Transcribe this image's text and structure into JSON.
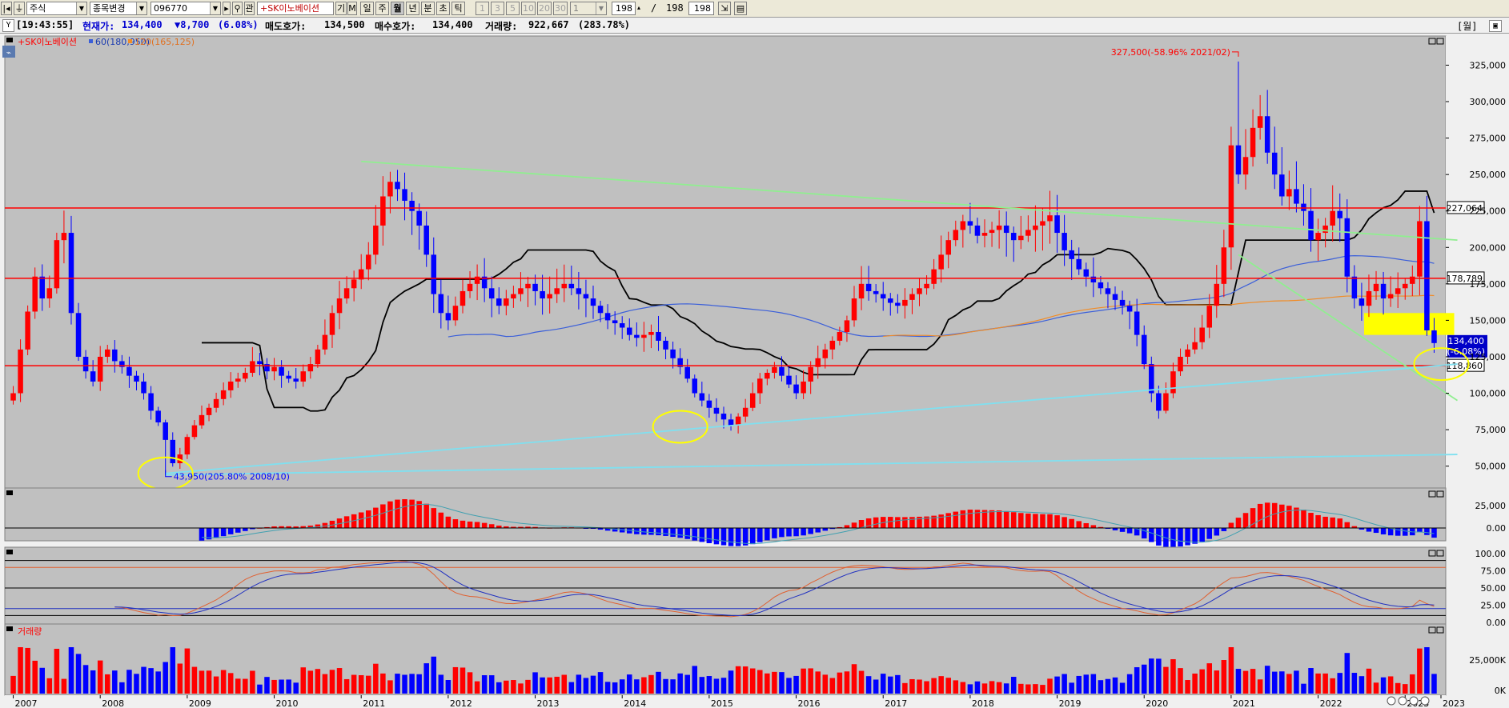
{
  "toolbar": {
    "market_type": "주식",
    "change_item": "종목변경",
    "code": "096770",
    "search_label": "관",
    "stock_name": "+SK이노베이션",
    "btn_gi": "기",
    "btn_m": "M",
    "periods": [
      "일",
      "주",
      "월",
      "년",
      "분",
      "초",
      "틱"
    ],
    "selected_period": "월",
    "intervals": [
      "1",
      "3",
      "5",
      "10",
      "20",
      "30"
    ],
    "interval_value": "1",
    "count_value": "198",
    "count_separator": "/",
    "count_total": "198",
    "count_input2": "198",
    "top_right_label": "[월]"
  },
  "infobar": {
    "time": "[19:43:55]",
    "current_price_label": "현재가:",
    "current_price": "134,400",
    "change": "▼8,700",
    "change_pct": "(6.08%)",
    "ask_label": "매도호가:",
    "ask": "134,500",
    "bid_label": "매수호가:",
    "bid": "134,400",
    "volume_label": "거래량:",
    "volume": "922,667",
    "volume_pct": "(283.78%)"
  },
  "legend": {
    "name": "+SK이노베이션",
    "ma60": "60(180,950)",
    "ma120": "120(165,125)",
    "volume_panel_title": "거래량"
  },
  "colors": {
    "up": "#ff0000",
    "down": "#0000ff",
    "background": "#c0c0c0",
    "ma60": "#3b5fd9",
    "ma120": "#f08c28",
    "cloud": "#000000",
    "trend_green": "#90ee90",
    "trend_cyan": "#7fe0f0",
    "highlight": "#ffff00",
    "signal_blue": "#2030c0",
    "signal_orange": "#e06030"
  },
  "annotations": {
    "high_label": "327,500(-58.96% 2021/02)",
    "low_label": "43,950(205.80% 2008/10)"
  },
  "chart_data": {
    "type": "candlestick",
    "x_axis_labels": [
      "2007",
      "2008",
      "2009",
      "2010",
      "2011",
      "2012",
      "2013",
      "2014",
      "2015",
      "2016",
      "2017",
      "2018",
      "2019",
      "2020",
      "2021",
      "2022",
      "2023",
      "2023"
    ],
    "price_axis": {
      "ticks": [
        "325,000",
        "300,000",
        "275,000",
        "250,000",
        "225,000",
        "200,000",
        "175,000",
        "150,000",
        "125,000",
        "100,000",
        "75,000",
        "50,000"
      ],
      "ylim": [
        35000,
        345000
      ]
    },
    "horizontal_levels": [
      227064,
      178789,
      118860
    ],
    "level_labels": [
      "227,064",
      "178,789",
      "118,860"
    ],
    "current_price_label": "134,400",
    "current_change_label": "(-6.08%)",
    "highlight_zone": {
      "start": "2022/08",
      "end": "2023/06",
      "low": 140000,
      "high": 155000
    },
    "circled_lows": [
      {
        "date": "2008/10",
        "value": 45000
      },
      {
        "date": "2014/09",
        "value": 77000
      },
      {
        "date": "2023/06",
        "value": 120000
      }
    ],
    "trendlines": [
      {
        "color": "green",
        "from": {
          "date": "2011/01",
          "value": 259000
        },
        "to": {
          "date": "2023/06",
          "value": 205000
        }
      },
      {
        "color": "green",
        "from": {
          "date": "2021/02",
          "value": 195000
        },
        "to": {
          "date": "2023/06",
          "value": 95000
        }
      },
      {
        "color": "cyan",
        "from": {
          "date": "2008/10",
          "value": 45000
        },
        "to": {
          "date": "2023/06",
          "value": 120000
        }
      },
      {
        "color": "cyan",
        "from": {
          "date": "2008/10",
          "value": 44000
        },
        "to": {
          "date": "2023/06",
          "value": 58000
        }
      }
    ],
    "monthly_close": [
      100000,
      130000,
      156000,
      180000,
      165000,
      172000,
      205000,
      210000,
      155000,
      125000,
      115000,
      108000,
      125000,
      130000,
      122000,
      118000,
      112000,
      108000,
      100000,
      88000,
      80000,
      68000,
      52000,
      58000,
      70000,
      78000,
      85000,
      90000,
      96000,
      102000,
      108000,
      110000,
      114000,
      122000,
      120000,
      115000,
      118000,
      112000,
      110000,
      108000,
      115000,
      120000,
      130000,
      140000,
      155000,
      165000,
      172000,
      178000,
      185000,
      195000,
      215000,
      235000,
      245000,
      240000,
      232000,
      225000,
      215000,
      195000,
      168000,
      155000,
      150000,
      160000,
      170000,
      175000,
      180000,
      172000,
      165000,
      160000,
      165000,
      168000,
      172000,
      175000,
      170000,
      165000,
      168000,
      172000,
      175000,
      172000,
      168000,
      165000,
      160000,
      155000,
      150000,
      148000,
      145000,
      140000,
      138000,
      140000,
      142000,
      136000,
      130000,
      124000,
      118000,
      110000,
      100000,
      95000,
      90000,
      86000,
      82000,
      78000,
      84000,
      90000,
      100000,
      110000,
      114000,
      118000,
      112000,
      106000,
      100000,
      108000,
      118000,
      124000,
      130000,
      136000,
      142000,
      150000,
      165000,
      175000,
      170000,
      168000,
      165000,
      162000,
      160000,
      164000,
      168000,
      172000,
      175000,
      185000,
      195000,
      205000,
      212000,
      218000,
      215000,
      208000,
      210000,
      212000,
      215000,
      210000,
      205000,
      208000,
      212000,
      215000,
      218000,
      222000,
      210000,
      198000,
      192000,
      185000,
      180000,
      176000,
      172000,
      168000,
      164000,
      160000,
      156000,
      140000,
      120000,
      100000,
      88000,
      100000,
      115000,
      125000,
      130000,
      135000,
      145000,
      160000,
      175000,
      200000,
      270000,
      250000,
      262000,
      282000,
      290000,
      265000,
      250000,
      235000,
      240000,
      230000,
      225000,
      205000,
      210000,
      215000,
      225000,
      220000,
      180000,
      165000,
      160000,
      170000,
      175000,
      165000,
      168000,
      172000,
      175000,
      180000,
      218000,
      143100,
      134400
    ],
    "ma60_values": [
      180950
    ],
    "ma120_values": [
      165125
    ],
    "macd_axis": {
      "ticks": [
        "25,000",
        "0.00"
      ]
    },
    "stoch_axis": {
      "ticks": [
        "100.00",
        "75.00",
        "50.00",
        "25.00",
        "0.00"
      ],
      "levels": [
        90,
        80,
        50,
        20,
        10
      ]
    },
    "volume_axis": {
      "ticks": [
        "25,000K",
        "0K"
      ]
    }
  }
}
